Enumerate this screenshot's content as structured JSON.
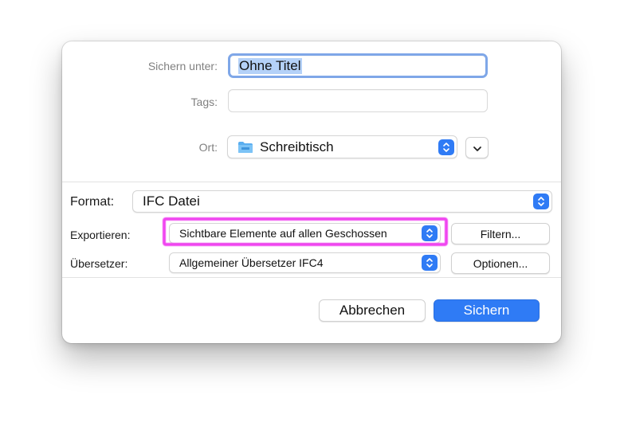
{
  "dialog": {
    "save_as": {
      "label": "Sichern unter:",
      "value": "Ohne Titel"
    },
    "tags": {
      "label": "Tags:",
      "value": ""
    },
    "location": {
      "label": "Ort:",
      "value": "Schreibtisch",
      "icon": "folder-icon"
    },
    "format": {
      "label": "Format:",
      "value": "IFC Datei"
    },
    "export": {
      "label": "Exportieren:",
      "value": "Sichtbare Elemente auf allen Geschossen",
      "button": "Filtern..."
    },
    "translator": {
      "label": "Übersetzer:",
      "value": "Allgemeiner Übersetzer IFC4",
      "button": "Optionen..."
    },
    "buttons": {
      "cancel": "Abbrechen",
      "save": "Sichern"
    }
  },
  "colors": {
    "accent": "#2f7bf5",
    "highlight": "#f045f0",
    "focus_ring": "#7fa7e8"
  }
}
